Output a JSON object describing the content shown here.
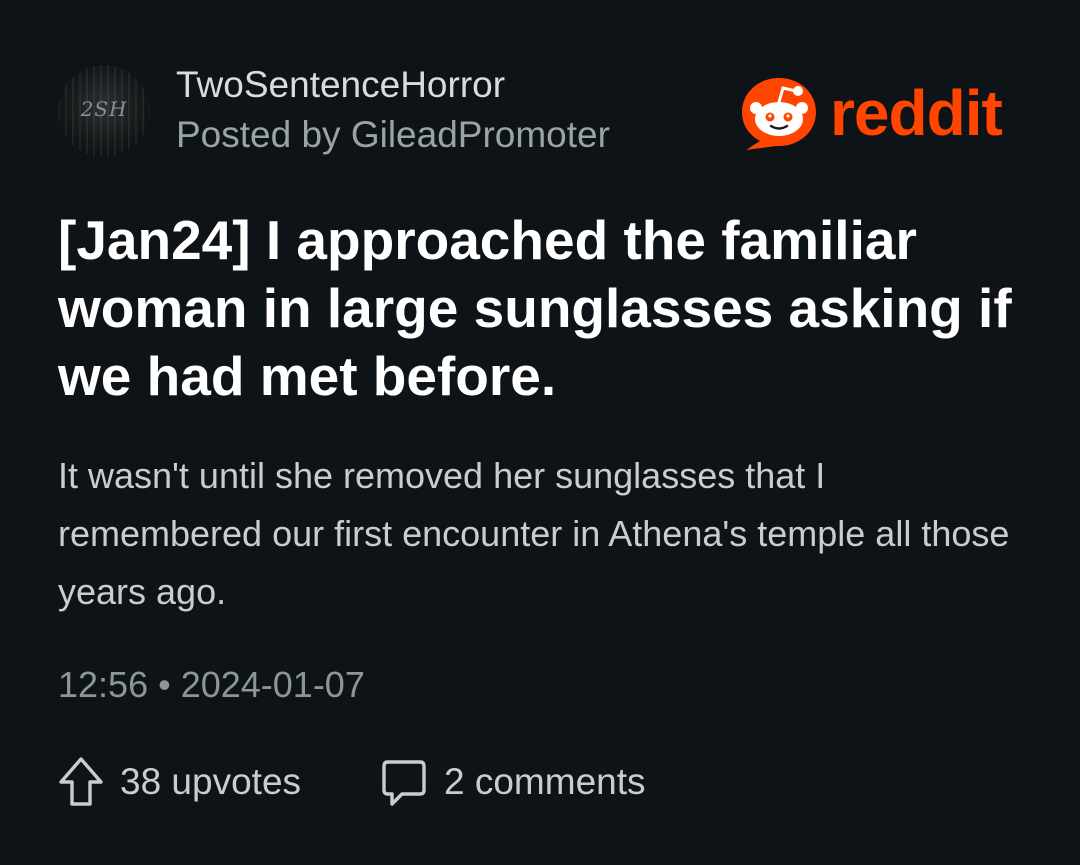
{
  "post": {
    "subreddit": "TwoSentenceHorror",
    "avatar_text": "2SH",
    "posted_by": "Posted by GileadPromoter",
    "title": "[Jan24] I approached the familiar woman in large sunglasses asking if we had met before.",
    "body": "It wasn't until she removed her sunglasses that I remembered our first encounter in Athena's temple all those years ago.",
    "timestamp": "12:56 • 2024-01-07",
    "upvotes_label": "38 upvotes",
    "comments_label": "2 comments"
  },
  "brand": {
    "wordmark": "reddit",
    "color": "#ff4500",
    "icon": "reddit-snoo-icon"
  },
  "theme": {
    "background": "#0e1317",
    "title_color": "#ffffff",
    "muted_text": "#9aa3a8"
  },
  "icons": {
    "upvote": "upvote-arrow-icon",
    "comment": "comment-bubble-icon"
  }
}
